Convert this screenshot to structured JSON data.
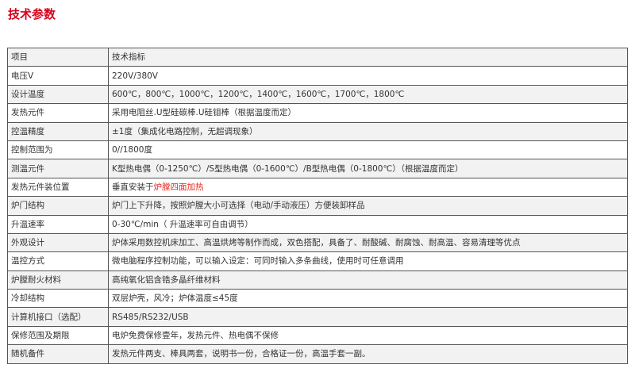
{
  "page": {
    "title": "技术参数"
  },
  "colors": {
    "title": "#d9001b",
    "highlight": "#e8281d",
    "row_alt_bg": "#f2f2f2",
    "border": "#555555"
  },
  "table": {
    "header": {
      "name": "项目",
      "value": "技术指标"
    },
    "rows": [
      {
        "name": "电压V",
        "value": "220V/380V"
      },
      {
        "name": "设计温度",
        "value": "600℃，800℃，1000℃，1200℃，1400℃，1600℃，1700℃，1800℃"
      },
      {
        "name": "发热元件",
        "value": "采用电阻丝.U型硅碳棒.U硅钼棒（根据温度而定）"
      },
      {
        "name": "控温精度",
        "value": "±1度（集成化电路控制，无超调现象）"
      },
      {
        "name": "控制范围为",
        "value": "0//1800度"
      },
      {
        "name": "测温元件",
        "value": "K型热电偶（0-1250℃）/S型热电偶（0-1600℃）/B型热电偶（0-1800℃）（根据温度而定）"
      },
      {
        "name": "发热元件装位置",
        "value": "垂直安装于",
        "value_highlight": "炉膛四面加热"
      },
      {
        "name": "炉门结构",
        "value": "炉门上下升降，按照炉膛大小可选择（电动/手动液压）方便装卸样品"
      },
      {
        "name": "升温速率",
        "value": "0-30℃/min（ 升温速率可自由调节）"
      },
      {
        "name": "外观设计",
        "value": "炉体采用数控机床加工、高温烘烤等制作而成，双色搭配，具备了、耐酸碱、耐腐蚀、耐高温、容易清理等优点"
      },
      {
        "name": "温控方式",
        "value": "微电脑程序控制功能，可以输入设定：可同时输入多条曲线，使用时可任意调用"
      },
      {
        "name": "炉膛耐火材料",
        "value": "高纯氧化铝含锆多晶纤维材料"
      },
      {
        "name": "冷却结构",
        "value": "双层炉壳，风冷；炉体温度≤45度"
      },
      {
        "name": "计算机接口（选配）",
        "value": "RS485/RS232/USB"
      },
      {
        "name": "保修范围及期限",
        "value": "电炉免费保修壹年，发热元件、热电偶不保修"
      },
      {
        "name": "随机备件",
        "value": "发热元件两支、棒具两套，说明书一份，合格证一份，高温手套一副。"
      }
    ]
  }
}
